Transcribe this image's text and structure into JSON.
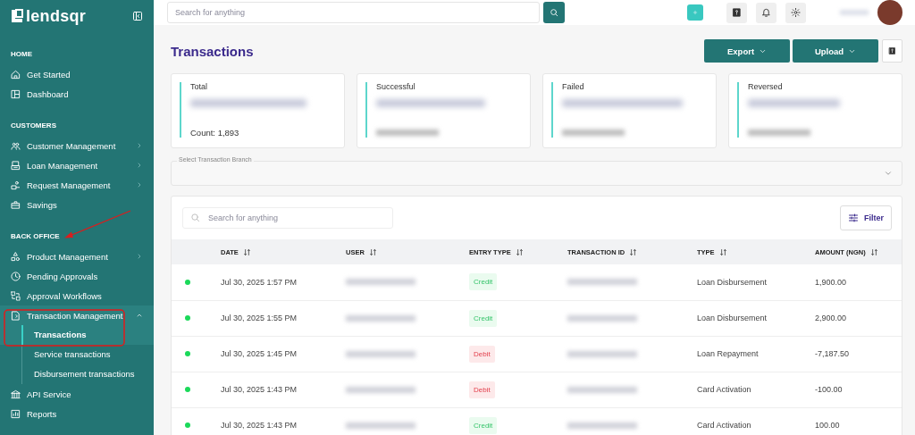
{
  "sidebar": {
    "logo": "lendsqr",
    "sections": [
      {
        "title": "HOME",
        "items": [
          {
            "label": "Get Started",
            "chevron": false
          },
          {
            "label": "Dashboard",
            "chevron": false
          }
        ]
      },
      {
        "title": "CUSTOMERS",
        "items": [
          {
            "label": "Customer Management",
            "chevron": true
          },
          {
            "label": "Loan Management",
            "chevron": true
          },
          {
            "label": "Request Management",
            "chevron": true
          },
          {
            "label": "Savings",
            "chevron": false
          }
        ]
      },
      {
        "title": "BACK OFFICE",
        "items": [
          {
            "label": "Product Management",
            "chevron": true
          },
          {
            "label": "Pending Approvals",
            "chevron": false
          },
          {
            "label": "Approval Workflows",
            "chevron": false
          },
          {
            "label": "Transaction Management",
            "chevron": true,
            "expanded": true,
            "children": [
              {
                "label": "Transactions",
                "selected": true
              },
              {
                "label": "Service transactions",
                "selected": false
              },
              {
                "label": "Disbursement transactions",
                "selected": false
              }
            ]
          },
          {
            "label": "API Service",
            "chevron": false
          },
          {
            "label": "Reports",
            "chevron": false
          }
        ]
      }
    ]
  },
  "topbar": {
    "search": {
      "placeholder": "Search for anything"
    }
  },
  "page": {
    "title": "Transactions",
    "actions": [
      {
        "label": "Export"
      },
      {
        "label": "Upload"
      }
    ]
  },
  "stats": [
    {
      "label": "Total",
      "count": "Count: 1,893"
    },
    {
      "label": "Successful"
    },
    {
      "label": "Failed"
    },
    {
      "label": "Reversed"
    }
  ],
  "branch_select": {
    "label": "Select Transaction Branch"
  },
  "table": {
    "search": {
      "placeholder": "Search for anything"
    },
    "filter": "Filter",
    "columns": [
      "DATE",
      "USER",
      "ENTRY TYPE",
      "TRANSACTION ID",
      "TYPE",
      "AMOUNT (NGN)"
    ],
    "rows": [
      {
        "date": "Jul 30, 2025 1:57 PM",
        "entry": {
          "label": "Credit",
          "kind": "credit"
        },
        "type": "Loan Disbursement",
        "amount": "1,900.00"
      },
      {
        "date": "Jul 30, 2025 1:55 PM",
        "entry": {
          "label": "Credit",
          "kind": "credit"
        },
        "type": "Loan Disbursement",
        "amount": "2,900.00"
      },
      {
        "date": "Jul 30, 2025 1:45 PM",
        "entry": {
          "label": "Debit",
          "kind": "debit"
        },
        "type": "Loan Repayment",
        "amount": "-7,187.50"
      },
      {
        "date": "Jul 30, 2025 1:43 PM",
        "entry": {
          "label": "Debit",
          "kind": "debit"
        },
        "type": "Card Activation",
        "amount": "-100.00"
      },
      {
        "date": "Jul 30, 2025 1:43 PM",
        "entry": {
          "label": "Credit",
          "kind": "credit"
        },
        "type": "Card Activation",
        "amount": "100.00"
      }
    ]
  }
}
